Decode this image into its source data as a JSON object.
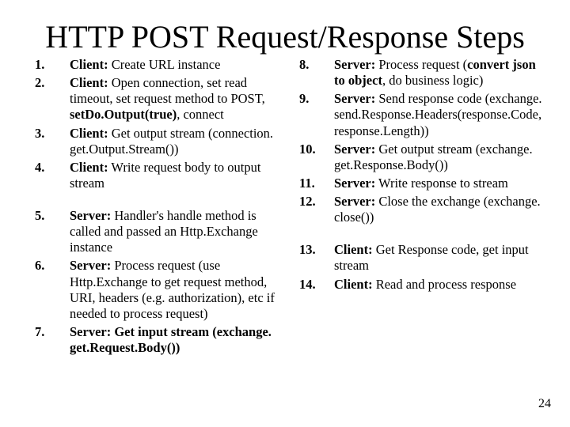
{
  "title": "HTTP POST Request/Response Steps",
  "page_number": "24",
  "left": [
    {
      "num": "1.",
      "role": "Client:",
      "text": " Create URL instance"
    },
    {
      "num": "2.",
      "role": "Client:",
      "text": " Open connection, set read timeout, set request method to POST, ",
      "bold_tail": "setDo.Output(true)",
      "tail": ", connect"
    },
    {
      "num": "3.",
      "role": "Client:",
      "text": " Get output stream (connection. get.Output.Stream())"
    },
    {
      "num": "4.",
      "role": "Client:",
      "text": " Write request body to output stream"
    },
    {
      "spacer": true
    },
    {
      "num": "5.",
      "role": "Server:",
      "text": " Handler's handle method is called and passed an Http.Exchange instance"
    },
    {
      "num": "6.",
      "role": "Server:",
      "text": " Process request (use Http.Exchange to get request method, URI, headers (e.g. authorization), etc if needed to process request)"
    },
    {
      "num": "7.",
      "role_bold_full": "Server: Get input stream (exchange. get.Request.Body())"
    }
  ],
  "right": [
    {
      "num": "8.",
      "role": "Server:",
      "text": " Process request (",
      "bold_mid": "convert json to object",
      "tail": ", do business logic)"
    },
    {
      "num": "9.",
      "role": "Server:",
      "text": " Send response code (exchange. send.Response.Headers(response.Code, response.Length))"
    },
    {
      "num": "10.",
      "role": "Server:",
      "text": " Get output stream (exchange. get.Response.Body())"
    },
    {
      "num": "11.",
      "role": "Server:",
      "text": " Write response to stream"
    },
    {
      "num": "12.",
      "role": "Server:",
      "text": " Close the exchange (exchange. close())"
    },
    {
      "spacer": true
    },
    {
      "num": "13.",
      "role": "Client:",
      "text": " Get Response code, get input stream"
    },
    {
      "num": "14.",
      "role": "Client:",
      "text": " Read and process response"
    }
  ]
}
